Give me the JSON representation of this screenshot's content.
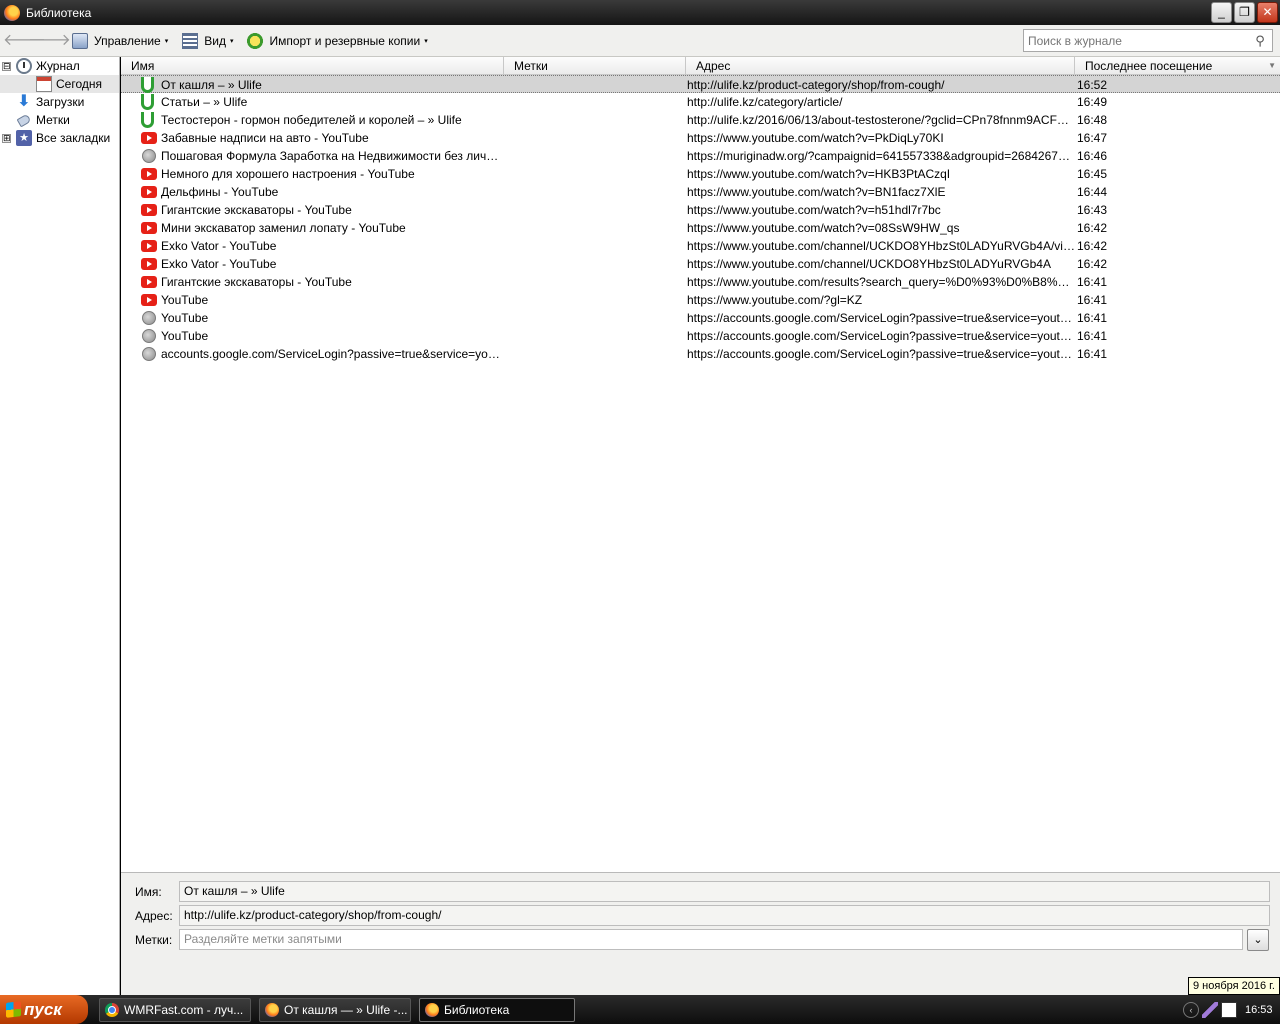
{
  "window": {
    "title": "Библиотека",
    "minimize_glyph": "_",
    "maximize_glyph": "❐",
    "close_glyph": "✕"
  },
  "toolbar": {
    "back_glyph": "🡐",
    "forward_glyph": "🡒",
    "manage_label": "Управление",
    "view_label": "Вид",
    "import_label": "Импорт и резервные копии",
    "dropdown_glyph": "▾",
    "search_placeholder": "Поиск в журнале",
    "search_glyph": "⚲"
  },
  "sidebar": {
    "items": [
      {
        "label": "Журнал",
        "expander": "⊟",
        "icon": "clock-icon",
        "level": 0
      },
      {
        "label": "Сегодня",
        "icon": "calendar-icon",
        "level": 1
      },
      {
        "label": "Загрузки",
        "icon": "download-icon",
        "level": 0
      },
      {
        "label": "Метки",
        "icon": "tag-icon",
        "level": 0
      },
      {
        "label": "Все закладки",
        "expander": "⊞",
        "icon": "bookmarks-star-icon",
        "level": 0
      }
    ],
    "download_glyph": "⬇",
    "star_glyph": "★"
  },
  "columns": {
    "name": "Имя",
    "tags": "Метки",
    "address": "Адрес",
    "last_visit": "Последнее посещение",
    "sort_glyph": "▼"
  },
  "history": [
    {
      "icon": "ulife",
      "name": "От кашля – » Ulife",
      "url": "http://ulife.kz/product-category/shop/from-cough/",
      "time": "16:52"
    },
    {
      "icon": "ulife",
      "name": "Статьи – » Ulife",
      "url": "http://ulife.kz/category/article/",
      "time": "16:49"
    },
    {
      "icon": "ulife",
      "name": "Тестостерон - гормон победителей и королей – » Ulife",
      "url": "http://ulife.kz/2016/06/13/about-testosterone/?gclid=CPn78fnnm9ACFQ1JGQ...",
      "time": "16:48"
    },
    {
      "icon": "youtube",
      "name": "Забавные надписи на авто - YouTube",
      "url": "https://www.youtube.com/watch?v=PkDiqLy70KI",
      "time": "16:47"
    },
    {
      "icon": "globe",
      "name": "Пошаговая Формула Заработка на Недвижимости без личного к...",
      "url": "https://muriginadw.org/?campaignid=641557338&adgroupid=26842672137&loc...",
      "time": "16:46"
    },
    {
      "icon": "youtube",
      "name": "Немного для хорошего настроения - YouTube",
      "url": "https://www.youtube.com/watch?v=HKB3PtACzqI",
      "time": "16:45"
    },
    {
      "icon": "youtube",
      "name": "Дельфины - YouTube",
      "url": "https://www.youtube.com/watch?v=BN1facz7XlE",
      "time": "16:44"
    },
    {
      "icon": "youtube",
      "name": "Гигантские экскаваторы - YouTube",
      "url": "https://www.youtube.com/watch?v=h51hdl7r7bc",
      "time": "16:43"
    },
    {
      "icon": "youtube",
      "name": "Мини экскаватор заменил лопату - YouTube",
      "url": "https://www.youtube.com/watch?v=08SsW9HW_qs",
      "time": "16:42"
    },
    {
      "icon": "youtube",
      "name": "Exko Vator - YouTube",
      "url": "https://www.youtube.com/channel/UCKDO8YHbzSt0LADYuRVGb4A/videos",
      "time": "16:42"
    },
    {
      "icon": "youtube",
      "name": "Exko Vator - YouTube",
      "url": "https://www.youtube.com/channel/UCKDO8YHbzSt0LADYuRVGb4A",
      "time": "16:42"
    },
    {
      "icon": "youtube",
      "name": "Гигантские экскаваторы - YouTube",
      "url": "https://www.youtube.com/results?search_query=%D0%93%D0%B8%D0%B3%D0%B0...",
      "time": "16:41"
    },
    {
      "icon": "youtube",
      "name": "YouTube",
      "url": "https://www.youtube.com/?gl=KZ",
      "time": "16:41"
    },
    {
      "icon": "globe",
      "name": "YouTube",
      "url": "https://accounts.google.com/ServiceLogin?passive=true&service=youtube&uile...",
      "time": "16:41"
    },
    {
      "icon": "globe",
      "name": "YouTube",
      "url": "https://accounts.google.com/ServiceLogin?passive=true&service=youtube&uile...",
      "time": "16:41"
    },
    {
      "icon": "globe",
      "name": "accounts.google.com/ServiceLogin?passive=true&service=youtube&ui...",
      "url": "https://accounts.google.com/ServiceLogin?passive=true&service=youtube&uile...",
      "time": "16:41"
    }
  ],
  "details": {
    "name_label": "Имя:",
    "name_value": "От кашля – » Ulife",
    "address_label": "Адрес:",
    "address_value": "http://ulife.kz/product-category/shop/from-cough/",
    "tags_label": "Метки:",
    "tags_placeholder": "Разделяйте метки запятыми",
    "tags_dropdown_glyph": "⌄"
  },
  "tooltip": {
    "text": "9 ноября 2016 г."
  },
  "taskbar": {
    "start_label": "пуск",
    "tasks": [
      {
        "label": "WMRFast.com - луч...",
        "icon": "chrome"
      },
      {
        "label": "От кашля — » Ulife -...",
        "icon": "firefox"
      },
      {
        "label": "Библиотека",
        "icon": "firefox",
        "active": true
      }
    ],
    "tray_arrow_glyph": "‹",
    "clock": "16:53"
  }
}
